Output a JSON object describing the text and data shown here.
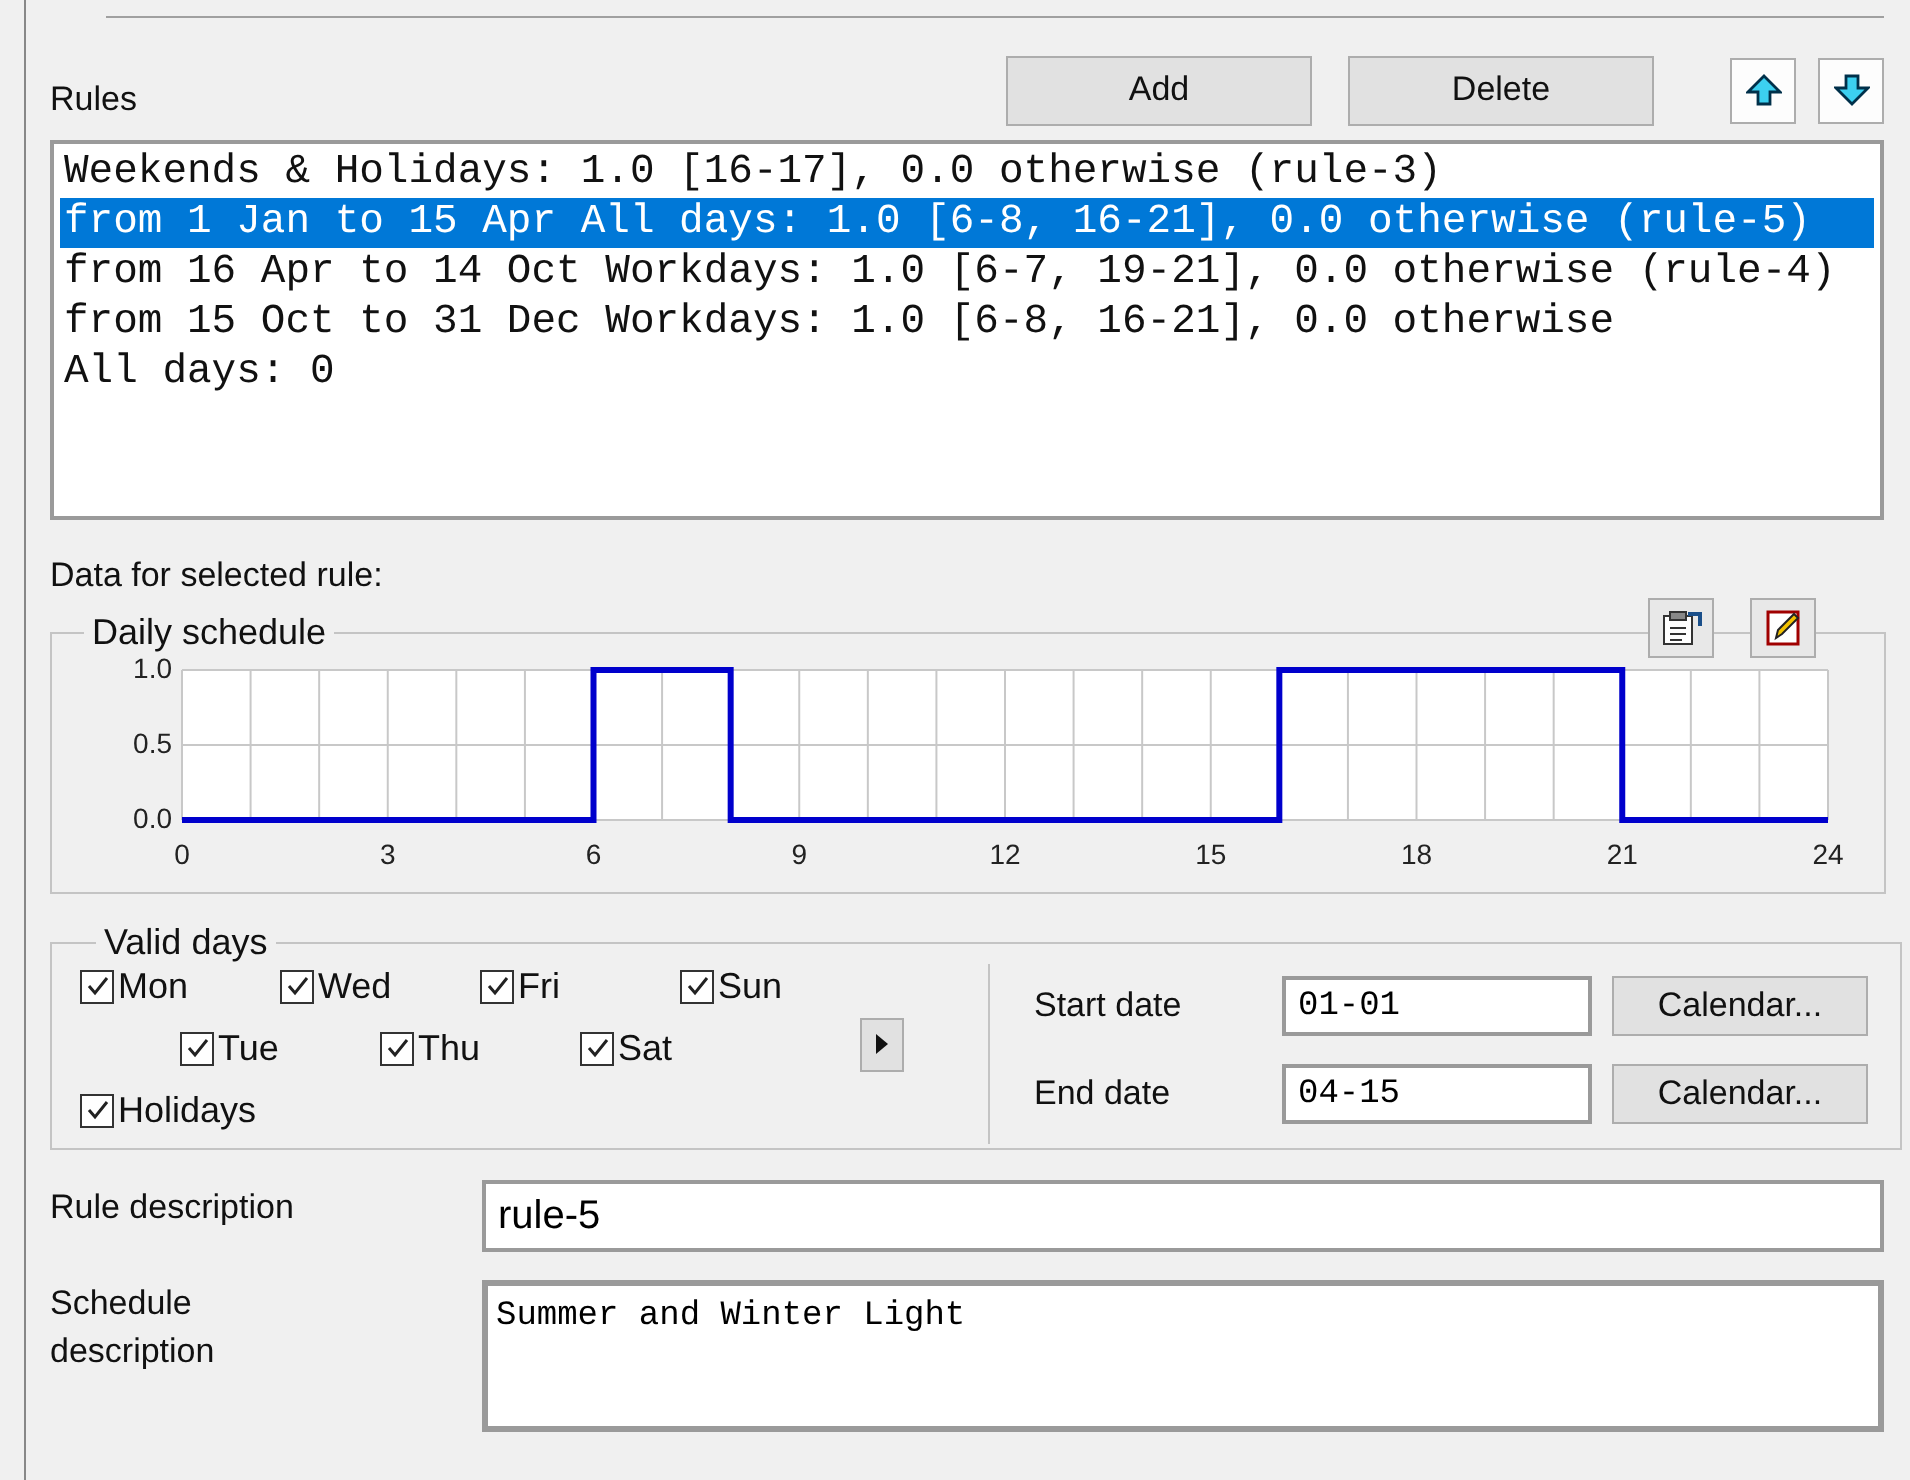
{
  "rules_header": {
    "label": "Rules",
    "buttons": [
      {
        "label": "Add"
      },
      {
        "label": "Delete"
      }
    ]
  },
  "rules": [
    {
      "text": "Weekends & Holidays: 1.0 [16-17], 0.0 otherwise (rule-3)",
      "selected": false
    },
    {
      "text": "from 1 Jan to 15 Apr All days: 1.0 [6-8, 16-21], 0.0 otherwise (rule-5)",
      "selected": true
    },
    {
      "text": "from 16 Apr to 14 Oct Workdays: 1.0 [6-7, 19-21], 0.0 otherwise (rule-4)",
      "selected": false
    },
    {
      "text": "from 15 Oct to 31 Dec Workdays: 1.0 [6-8, 16-21], 0.0 otherwise",
      "selected": false
    },
    {
      "text": "All days: 0",
      "selected": false
    }
  ],
  "data_label": "Data for selected rule:",
  "daily_schedule": {
    "title": "Daily schedule",
    "chart_data": {
      "type": "line",
      "x": [
        0,
        6,
        6,
        8,
        8,
        16,
        16,
        21,
        21,
        24
      ],
      "series": [
        {
          "color": "#0000cc",
          "values": [
            0,
            0,
            1,
            1,
            0,
            0,
            1,
            1,
            0,
            0
          ]
        }
      ],
      "xlim": [
        0,
        24
      ],
      "ylim": [
        0,
        1
      ],
      "xticks": [
        0,
        3,
        6,
        9,
        12,
        15,
        18,
        21,
        24
      ],
      "grid": true,
      "yticks": [
        {
          "value": 0,
          "label": "0.0"
        },
        {
          "value": 0.5,
          "label": "0.5"
        },
        {
          "value": 1,
          "label": "1.0"
        }
      ]
    }
  },
  "valid_days": {
    "title": "Valid days",
    "days": [
      {
        "label": "Mon",
        "checked": true
      },
      {
        "label": "Wed",
        "checked": true
      },
      {
        "label": "Fri",
        "checked": true
      },
      {
        "label": "Sun",
        "checked": true
      },
      {
        "label": "Tue",
        "checked": true
      },
      {
        "label": "Thu",
        "checked": true
      },
      {
        "label": "Sat",
        "checked": true
      },
      {
        "label": "Holidays",
        "checked": true
      }
    ]
  },
  "dates": [
    {
      "label": "Start date",
      "value": "01-01",
      "button": "Calendar..."
    },
    {
      "label": "End date",
      "value": "04-15",
      "button": "Calendar..."
    }
  ],
  "rule_description": {
    "label": "Rule description",
    "value": "rule-5"
  },
  "schedule_description": {
    "label": "Schedule description",
    "value": "Summer and Winter Light"
  }
}
